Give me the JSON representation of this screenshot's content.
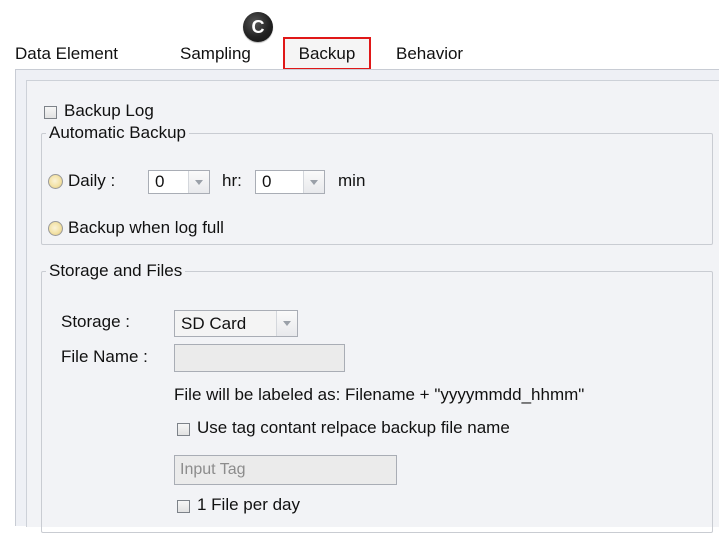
{
  "marker": {
    "letter": "C"
  },
  "tabs": [
    {
      "label": "Data Element"
    },
    {
      "label": "Sampling"
    },
    {
      "label": "Backup",
      "active": true
    },
    {
      "label": "Behavior"
    }
  ],
  "backup_log": {
    "label": "Backup Log",
    "checked": false
  },
  "automatic_backup": {
    "title": "Automatic Backup",
    "daily": {
      "label": "Daily :",
      "hour_value": "0",
      "hour_unit": "hr:",
      "minute_value": "0",
      "minute_unit": "min"
    },
    "log_full": {
      "label": "Backup when log full"
    }
  },
  "storage_and_files": {
    "title": "Storage and Files",
    "storage": {
      "label": "Storage :",
      "value": "SD Card"
    },
    "file_name": {
      "label": "File Name :",
      "value": ""
    },
    "file_label_note": "File will be labeled as: Filename + \"yyyymmdd_hhmm\"",
    "use_tag": {
      "label": "Use tag contant relpace backup file name",
      "checked": false
    },
    "input_tag": {
      "placeholder": "Input Tag"
    },
    "one_file_per_day": {
      "label": "1 File per day",
      "checked": false
    }
  },
  "colors": {
    "highlight_border": "#e01818",
    "panel_background": "#eef0f5",
    "radio_fill": "#f3e2a6"
  }
}
